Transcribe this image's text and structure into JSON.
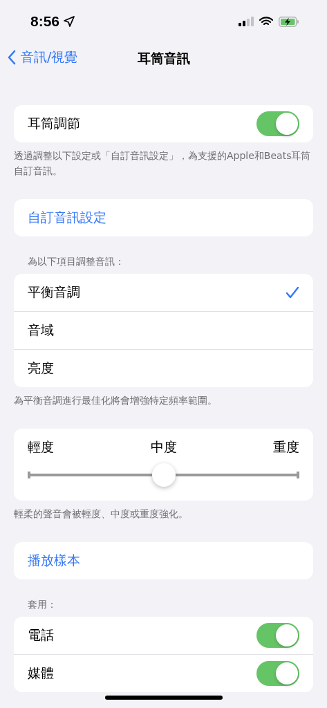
{
  "status_bar": {
    "time": "8:56"
  },
  "nav": {
    "back": "音訊/視覺",
    "title": "耳筒音訊"
  },
  "sections": [
    {
      "kind": "toggle",
      "rows": [
        {
          "label": "耳筒調節",
          "on": true
        }
      ],
      "footer": "透過調整以下設定或「自訂音訊設定」，為支援的Apple和Beats耳筒自訂音訊。"
    },
    {
      "kind": "link",
      "rows": [
        {
          "label": "自訂音訊設定"
        }
      ]
    },
    {
      "kind": "choice",
      "header": "為以下項目調整音訊：",
      "rows": [
        {
          "label": "平衡音調",
          "selected": true
        },
        {
          "label": "音域",
          "selected": false
        },
        {
          "label": "亮度",
          "selected": false
        }
      ],
      "footer": "為平衡音調進行最佳化將會增強特定頻率範圍。"
    },
    {
      "kind": "slider",
      "labels": [
        "輕度",
        "中度",
        "重度"
      ],
      "level": 0.5,
      "footer": "輕柔的聲音會被輕度、中度或重度強化。"
    },
    {
      "kind": "link",
      "rows": [
        {
          "label": "播放樣本"
        }
      ]
    },
    {
      "kind": "toggle",
      "header": "套用：",
      "rows": [
        {
          "label": "電話",
          "on": true
        },
        {
          "label": "媒體",
          "on": true
        }
      ]
    }
  ]
}
